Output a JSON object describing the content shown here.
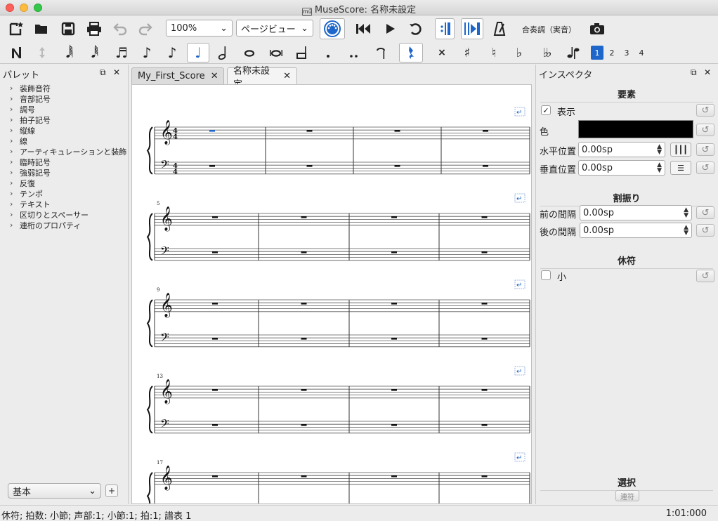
{
  "window": {
    "title": "MuseScore: 名称未設定",
    "app_icon_text": "mű"
  },
  "toolbar": {
    "zoom": "100%",
    "view_mode": "ページビュー",
    "concert_pitch_label": "合奏調（実音）",
    "voices": [
      "1",
      "2",
      "3",
      "4"
    ],
    "active_voice": "1"
  },
  "palette": {
    "title": "パレット",
    "items": [
      "装飾音符",
      "音部記号",
      "調号",
      "拍子記号",
      "縦線",
      "線",
      "アーティキュレーションと装飾",
      "臨時記号",
      "強弱記号",
      "反復",
      "テンポ",
      "テキスト",
      "区切りとスペーサー",
      "連桁のプロパティ"
    ],
    "workspace": "基本",
    "add_label": "+"
  },
  "tabs": [
    {
      "label": "My_First_Score",
      "active": false
    },
    {
      "label": "名称未設定",
      "active": true
    }
  ],
  "score": {
    "time_signature": {
      "numerator": "4",
      "denominator": "4"
    },
    "measure_numbers": [
      "5",
      "9",
      "13",
      "17"
    ]
  },
  "inspector": {
    "title": "インスペクタ",
    "element_section": "要素",
    "visible_label": "表示",
    "visible_checked": true,
    "color_label": "色",
    "color_value": "#000000",
    "offset_x_label": "水平位置",
    "offset_x_value": "0.00sp",
    "offset_y_label": "垂直位置",
    "offset_y_value": "0.00sp",
    "segment_section": "割振り",
    "leading_space_label": "前の間隔",
    "leading_space_value": "0.00sp",
    "trailing_space_label": "後の間隔",
    "trailing_space_value": "0.00sp",
    "rest_section": "休符",
    "small_label": "小",
    "small_checked": false,
    "select_section": "選択",
    "select_button": "連符"
  },
  "statusbar": {
    "left": "休符; 拍数: 小節; 声部:1;  小節:1; 拍:1; 譜表 1",
    "right": "1:01:000"
  },
  "colors": {
    "selection_blue": "#1e66c9",
    "accent": "#1e66c9"
  }
}
